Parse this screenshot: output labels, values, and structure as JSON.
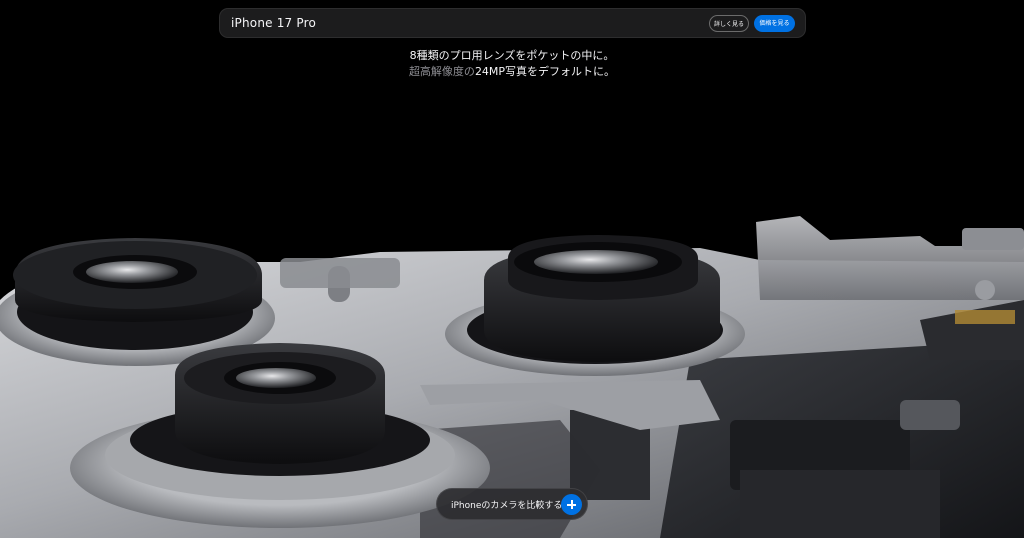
{
  "product_bar": {
    "name": "iPhone 17 Pro",
    "details_label": "詳しく見る",
    "price_label": "価格を見る"
  },
  "headline": {
    "line1": "8種類のプロ用レンズをポケットの中に。",
    "line2_part1": "超高解像度の",
    "line2_part2": "24MP写真をデフォルトに。"
  },
  "compare": {
    "label": "iPhoneのカメラを比較する",
    "icon": "plus-icon"
  },
  "colors": {
    "background": "#000000",
    "accent": "#0071e3",
    "muted_text": "#8e8e93"
  },
  "hero": {
    "subject": "camera-module-closeup"
  }
}
